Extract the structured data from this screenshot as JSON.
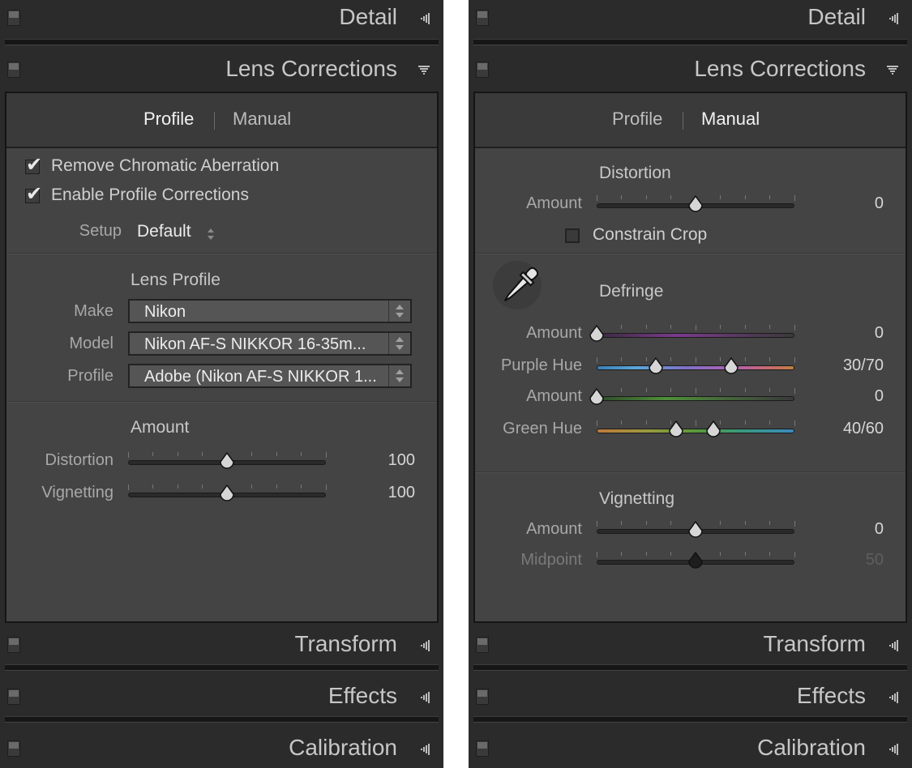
{
  "left_panel": {
    "headers": {
      "detail": "Detail",
      "lens_corrections": "Lens Corrections",
      "transform": "Transform",
      "effects": "Effects",
      "calibration": "Calibration"
    },
    "tabs": {
      "profile": "Profile",
      "manual": "Manual",
      "active": "Profile"
    },
    "checkboxes": [
      {
        "label": "Remove Chromatic Aberration",
        "checked": true
      },
      {
        "label": "Enable Profile Corrections",
        "checked": true
      }
    ],
    "setup": {
      "label": "Setup",
      "value": "Default"
    },
    "lens_profile": {
      "title": "Lens Profile",
      "make_label": "Make",
      "make_value": "Nikon",
      "model_label": "Model",
      "model_value": "Nikon AF-S NIKKOR 16-35m...",
      "profile_label": "Profile",
      "profile_value": "Adobe (Nikon AF-S NIKKOR 1..."
    },
    "amount": {
      "title": "Amount",
      "distortion_label": "Distortion",
      "distortion_value": "100",
      "distortion_pos": 0.5,
      "vignetting_label": "Vignetting",
      "vignetting_value": "100",
      "vignetting_pos": 0.5
    }
  },
  "right_panel": {
    "headers": {
      "detail": "Detail",
      "lens_corrections": "Lens Corrections",
      "transform": "Transform",
      "effects": "Effects",
      "calibration": "Calibration"
    },
    "tabs": {
      "profile": "Profile",
      "manual": "Manual",
      "active": "Manual"
    },
    "distortion": {
      "title": "Distortion",
      "amount_label": "Amount",
      "amount_value": "0",
      "amount_pos": 0.5,
      "constrain_label": "Constrain Crop",
      "constrain_checked": false
    },
    "defringe": {
      "title": "Defringe",
      "purple_amount_label": "Amount",
      "purple_amount_value": "0",
      "purple_amount_pos": 0.0,
      "purple_hue_label": "Purple Hue",
      "purple_hue_value": "30/70",
      "purple_hue_low": 0.3,
      "purple_hue_high": 0.68,
      "green_amount_label": "Amount",
      "green_amount_value": "0",
      "green_amount_pos": 0.0,
      "green_hue_label": "Green Hue",
      "green_hue_value": "40/60",
      "green_hue_low": 0.4,
      "green_hue_high": 0.59
    },
    "vignetting": {
      "title": "Vignetting",
      "amount_label": "Amount",
      "amount_value": "0",
      "amount_pos": 0.5,
      "midpoint_label": "Midpoint",
      "midpoint_value": "50",
      "midpoint_pos": 0.5
    }
  },
  "icons": {
    "panel_switch": "panel-switch-icon",
    "collapse": "collapse-triangle-icon",
    "expand": "expand-triangle-icon",
    "eyedropper": "eyedropper-icon",
    "stepper": "stepper-icon",
    "checkmark": "checkmark-icon"
  },
  "colors": {
    "panel_bg": "#2b2b2b",
    "body_bg": "#444444",
    "purple_track": "#8a3f9a",
    "green_track": "#4f8f3a"
  }
}
